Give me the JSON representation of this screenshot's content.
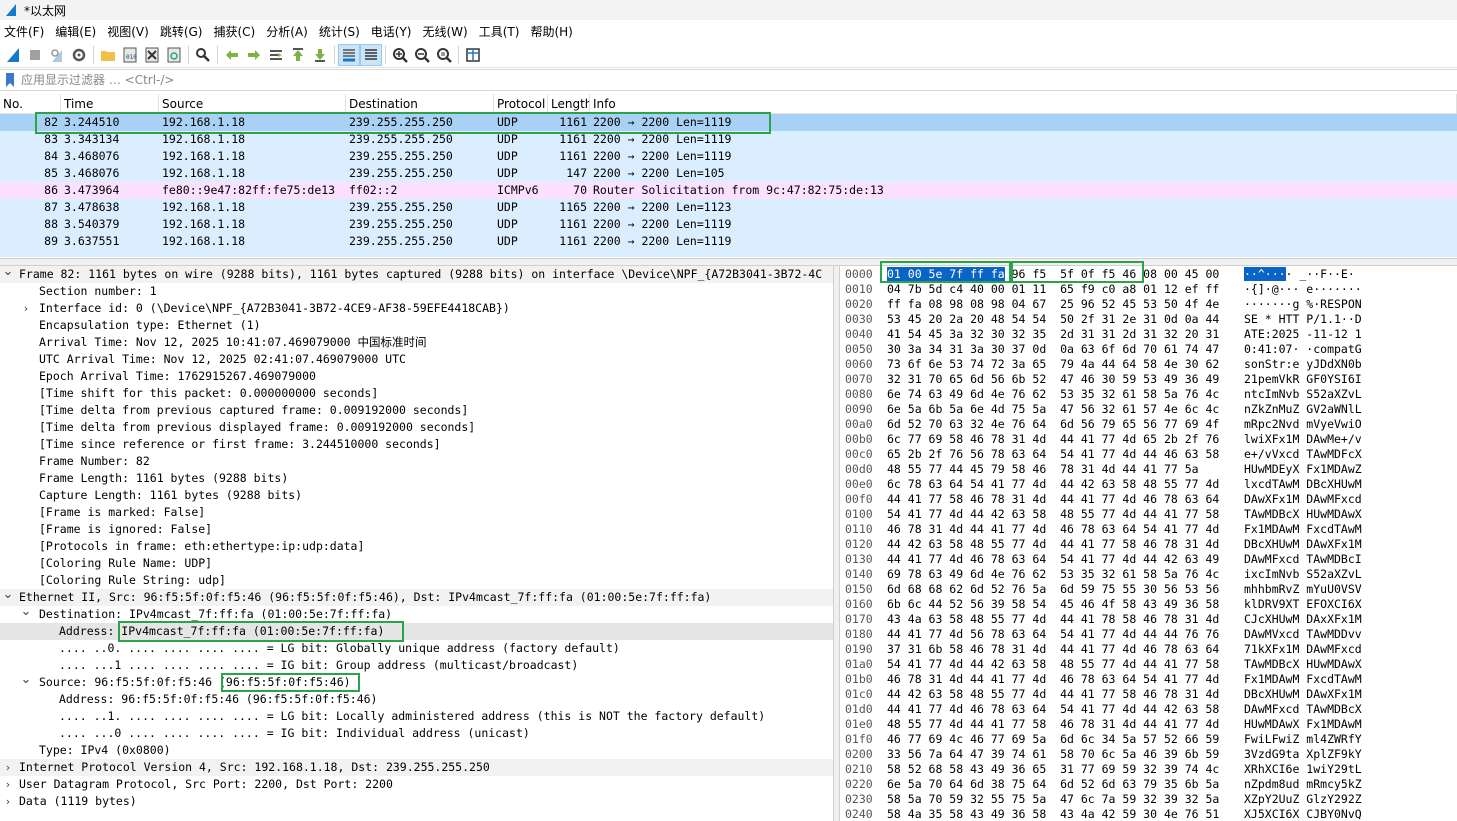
{
  "window": {
    "title": "*以太网"
  },
  "menu": [
    "文件(F)",
    "编辑(E)",
    "视图(V)",
    "跳转(G)",
    "捕获(C)",
    "分析(A)",
    "统计(S)",
    "电话(Y)",
    "无线(W)",
    "工具(T)",
    "帮助(H)"
  ],
  "toolbar": {
    "icons": [
      "shark-fin-start-icon",
      "stop-square-icon",
      "restart-fin-icon",
      "options-gear-icon",
      "open-folder-icon",
      "save-file-icon",
      "close-file-icon",
      "reload-icon",
      "find-magnifier-icon",
      "go-back-arrow-icon",
      "go-forward-arrow-icon",
      "go-to-packet-icon",
      "go-first-icon",
      "go-last-icon",
      "autoscroll-icon",
      "colorize-icon",
      "zoom-in-icon",
      "zoom-out-icon",
      "zoom-normal-icon",
      "resize-columns-icon"
    ]
  },
  "filter": {
    "placeholder": "应用显示过滤器 … <Ctrl-/>"
  },
  "packet_list": {
    "columns": [
      "No.",
      "Time",
      "Source",
      "Destination",
      "Protocol",
      "Length",
      "Info"
    ],
    "rows": [
      {
        "no": "82",
        "time": "3.244510",
        "src": "192.168.1.18",
        "dst": "239.255.255.250",
        "proto": "UDP",
        "len": "1161",
        "info": "2200 → 2200 Len=1119",
        "style": "selected"
      },
      {
        "no": "83",
        "time": "3.343134",
        "src": "192.168.1.18",
        "dst": "239.255.255.250",
        "proto": "UDP",
        "len": "1161",
        "info": "2200 → 2200 Len=1119",
        "style": "udp"
      },
      {
        "no": "84",
        "time": "3.468076",
        "src": "192.168.1.18",
        "dst": "239.255.255.250",
        "proto": "UDP",
        "len": "1161",
        "info": "2200 → 2200 Len=1119",
        "style": "udp"
      },
      {
        "no": "85",
        "time": "3.468076",
        "src": "192.168.1.18",
        "dst": "239.255.255.250",
        "proto": "UDP",
        "len": "147",
        "info": "2200 → 2200 Len=105",
        "style": "udp"
      },
      {
        "no": "86",
        "time": "3.473964",
        "src": "fe80::9e47:82ff:fe75:de13",
        "dst": "ff02::2",
        "proto": "ICMPv6",
        "len": "70",
        "info": "Router Solicitation from 9c:47:82:75:de:13",
        "style": "icmp"
      },
      {
        "no": "87",
        "time": "3.478638",
        "src": "192.168.1.18",
        "dst": "239.255.255.250",
        "proto": "UDP",
        "len": "1165",
        "info": "2200 → 2200 Len=1123",
        "style": "udp"
      },
      {
        "no": "88",
        "time": "3.540379",
        "src": "192.168.1.18",
        "dst": "239.255.255.250",
        "proto": "UDP",
        "len": "1161",
        "info": "2200 → 2200 Len=1119",
        "style": "udp"
      },
      {
        "no": "89",
        "time": "3.637551",
        "src": "192.168.1.18",
        "dst": "239.255.255.250",
        "proto": "UDP",
        "len": "1161",
        "info": "2200 → 2200 Len=1119",
        "style": "udp"
      }
    ]
  },
  "details": [
    {
      "indent": 0,
      "arrow": "open",
      "text": "Frame 82: 1161 bytes on wire (9288 bits), 1161 bytes captured (9288 bits) on interface \\Device\\NPF_{A72B3041-3B72-4C",
      "style": "top"
    },
    {
      "indent": 1,
      "arrow": "",
      "text": "Section number: 1"
    },
    {
      "indent": 1,
      "arrow": "closed",
      "text": "Interface id: 0 (\\Device\\NPF_{A72B3041-3B72-4CE9-AF38-59EFE4418CAB})"
    },
    {
      "indent": 1,
      "arrow": "",
      "text": "Encapsulation type: Ethernet (1)"
    },
    {
      "indent": 1,
      "arrow": "",
      "text": "Arrival Time: Nov 12, 2025 10:41:07.469079000 中国标准时间"
    },
    {
      "indent": 1,
      "arrow": "",
      "text": "UTC Arrival Time: Nov 12, 2025 02:41:07.469079000 UTC"
    },
    {
      "indent": 1,
      "arrow": "",
      "text": "Epoch Arrival Time: 1762915267.469079000"
    },
    {
      "indent": 1,
      "arrow": "",
      "text": "[Time shift for this packet: 0.000000000 seconds]"
    },
    {
      "indent": 1,
      "arrow": "",
      "text": "[Time delta from previous captured frame: 0.009192000 seconds]"
    },
    {
      "indent": 1,
      "arrow": "",
      "text": "[Time delta from previous displayed frame: 0.009192000 seconds]"
    },
    {
      "indent": 1,
      "arrow": "",
      "text": "[Time since reference or first frame: 3.244510000 seconds]"
    },
    {
      "indent": 1,
      "arrow": "",
      "text": "Frame Number: 82"
    },
    {
      "indent": 1,
      "arrow": "",
      "text": "Frame Length: 1161 bytes (9288 bits)"
    },
    {
      "indent": 1,
      "arrow": "",
      "text": "Capture Length: 1161 bytes (9288 bits)"
    },
    {
      "indent": 1,
      "arrow": "",
      "text": "[Frame is marked: False]"
    },
    {
      "indent": 1,
      "arrow": "",
      "text": "[Frame is ignored: False]"
    },
    {
      "indent": 1,
      "arrow": "",
      "text": "[Protocols in frame: eth:ethertype:ip:udp:data]"
    },
    {
      "indent": 1,
      "arrow": "",
      "text": "[Coloring Rule Name: UDP]"
    },
    {
      "indent": 1,
      "arrow": "",
      "text": "[Coloring Rule String: udp]"
    },
    {
      "indent": 0,
      "arrow": "open",
      "text": "Ethernet II, Src: 96:f5:5f:0f:f5:46 (96:f5:5f:0f:f5:46), Dst: IPv4mcast_7f:ff:fa (01:00:5e:7f:ff:fa)",
      "style": "top"
    },
    {
      "indent": 1,
      "arrow": "open",
      "text": "Destination: IPv4mcast_7f:ff:fa (01:00:5e:7f:ff:fa)"
    },
    {
      "indent": 2,
      "arrow": "",
      "text": "Address: IPv4mcast_7f:ff:fa (01:00:5e:7f:ff:fa)",
      "style": "sel"
    },
    {
      "indent": 2,
      "arrow": "",
      "text": ".... ..0. .... .... .... .... = LG bit: Globally unique address (factory default)"
    },
    {
      "indent": 2,
      "arrow": "",
      "text": ".... ...1 .... .... .... .... = IG bit: Group address (multicast/broadcast)"
    },
    {
      "indent": 1,
      "arrow": "open",
      "text": "Source: 96:f5:5f:0f:f5:46 (96:f5:5f:0f:f5:46)"
    },
    {
      "indent": 2,
      "arrow": "",
      "text": "Address: 96:f5:5f:0f:f5:46 (96:f5:5f:0f:f5:46)"
    },
    {
      "indent": 2,
      "arrow": "",
      "text": ".... ..1. .... .... .... .... = LG bit: Locally administered address (this is NOT the factory default)"
    },
    {
      "indent": 2,
      "arrow": "",
      "text": ".... ...0 .... .... .... .... = IG bit: Individual address (unicast)"
    },
    {
      "indent": 1,
      "arrow": "",
      "text": "Type: IPv4 (0x0800)"
    },
    {
      "indent": 0,
      "arrow": "closed",
      "text": "Internet Protocol Version 4, Src: 192.168.1.18, Dst: 239.255.255.250",
      "style": "top"
    },
    {
      "indent": 0,
      "arrow": "closed",
      "text": "User Datagram Protocol, Src Port: 2200, Dst Port: 2200"
    },
    {
      "indent": 0,
      "arrow": "closed",
      "text": "Data (1119 bytes)"
    }
  ],
  "hex": [
    {
      "off": "0000",
      "bytes": "01 00 5e 7f ff fa 96 f5  5f 0f f5 46 08 00 45 00",
      "ascii": "··^···· _··F··E·"
    },
    {
      "off": "0010",
      "bytes": "04 7b 5d c4 40 00 01 11  65 f9 c0 a8 01 12 ef ff",
      "ascii": "·{]·@··· e·······"
    },
    {
      "off": "0020",
      "bytes": "ff fa 08 98 08 98 04 67  25 96 52 45 53 50 4f 4e",
      "ascii": "·······g %·RESPON"
    },
    {
      "off": "0030",
      "bytes": "53 45 20 2a 20 48 54 54  50 2f 31 2e 31 0d 0a 44",
      "ascii": "SE * HTT P/1.1··D"
    },
    {
      "off": "0040",
      "bytes": "41 54 45 3a 32 30 32 35  2d 31 31 2d 31 32 20 31",
      "ascii": "ATE:2025 -11-12 1"
    },
    {
      "off": "0050",
      "bytes": "30 3a 34 31 3a 30 37 0d  0a 63 6f 6d 70 61 74 47",
      "ascii": "0:41:07· ·compatG"
    },
    {
      "off": "0060",
      "bytes": "73 6f 6e 53 74 72 3a 65  79 4a 44 64 58 4e 30 62",
      "ascii": "sonStr:e yJDdXN0b"
    },
    {
      "off": "0070",
      "bytes": "32 31 70 65 6d 56 6b 52  47 46 30 59 53 49 36 49",
      "ascii": "21pemVkR GF0YSI6I"
    },
    {
      "off": "0080",
      "bytes": "6e 74 63 49 6d 4e 76 62  53 35 32 61 58 5a 76 4c",
      "ascii": "ntcImNvb S52aXZvL"
    },
    {
      "off": "0090",
      "bytes": "6e 5a 6b 5a 6e 4d 75 5a  47 56 32 61 57 4e 6c 4c",
      "ascii": "nZkZnMuZ GV2aWNlL"
    },
    {
      "off": "00a0",
      "bytes": "6d 52 70 63 32 4e 76 64  6d 56 79 65 56 77 69 4f",
      "ascii": "mRpc2Nvd mVyeVwiO"
    },
    {
      "off": "00b0",
      "bytes": "6c 77 69 58 46 78 31 4d  44 41 77 4d 65 2b 2f 76",
      "ascii": "lwiXFx1M DAwMe+/v"
    },
    {
      "off": "00c0",
      "bytes": "65 2b 2f 76 56 78 63 64  54 41 77 4d 44 46 63 58",
      "ascii": "e+/vVxcd TAwMDFcX"
    },
    {
      "off": "00d0",
      "bytes": "48 55 77 44 45 79 58 46  78 31 4d 44 41 77 5a",
      "ascii": "HUwMDEyX Fx1MDAwZ"
    },
    {
      "off": "00e0",
      "bytes": "6c 78 63 64 54 41 77 4d  44 42 63 58 48 55 77 4d",
      "ascii": "lxcdTAwM DBcXHUwM"
    },
    {
      "off": "00f0",
      "bytes": "44 41 77 58 46 78 31 4d  44 41 77 4d 46 78 63 64",
      "ascii": "DAwXFx1M DAwMFxcd"
    },
    {
      "off": "0100",
      "bytes": "54 41 77 4d 44 42 63 58  48 55 77 4d 44 41 77 58",
      "ascii": "TAwMDBcX HUwMDAwX"
    },
    {
      "off": "0110",
      "bytes": "46 78 31 4d 44 41 77 4d  46 78 63 64 54 41 77 4d",
      "ascii": "Fx1MDAwM FxcdTAwM"
    },
    {
      "off": "0120",
      "bytes": "44 42 63 58 48 55 77 4d  44 41 77 58 46 78 31 4d",
      "ascii": "DBcXHUwM DAwXFx1M"
    },
    {
      "off": "0130",
      "bytes": "44 41 77 4d 46 78 63 64  54 41 77 4d 44 42 63 49",
      "ascii": "DAwMFxcd TAwMDBcI"
    },
    {
      "off": "0140",
      "bytes": "69 78 63 49 6d 4e 76 62  53 35 32 61 58 5a 76 4c",
      "ascii": "ixcImNvb S52aXZvL"
    },
    {
      "off": "0150",
      "bytes": "6d 68 68 62 6d 52 76 5a  6d 59 75 55 30 56 53 56",
      "ascii": "mhhbmRvZ mYuU0VSV"
    },
    {
      "off": "0160",
      "bytes": "6b 6c 44 52 56 39 58 54  45 46 4f 58 43 49 36 58",
      "ascii": "klDRV9XT EFOXCI6X"
    },
    {
      "off": "0170",
      "bytes": "43 4a 63 58 48 55 77 4d  44 41 78 58 46 78 31 4d",
      "ascii": "CJcXHUwM DAxXFx1M"
    },
    {
      "off": "0180",
      "bytes": "44 41 77 4d 56 78 63 64  54 41 77 4d 44 44 76 76",
      "ascii": "DAwMVxcd TAwMDDvv"
    },
    {
      "off": "0190",
      "bytes": "37 31 6b 58 46 78 31 4d  44 41 77 4d 46 78 63 64",
      "ascii": "71kXFx1M DAwMFxcd"
    },
    {
      "off": "01a0",
      "bytes": "54 41 77 4d 44 42 63 58  48 55 77 4d 44 41 77 58",
      "ascii": "TAwMDBcX HUwMDAwX"
    },
    {
      "off": "01b0",
      "bytes": "46 78 31 4d 44 41 77 4d  46 78 63 64 54 41 77 4d",
      "ascii": "Fx1MDAwM FxcdTAwM"
    },
    {
      "off": "01c0",
      "bytes": "44 42 63 58 48 55 77 4d  44 41 77 58 46 78 31 4d",
      "ascii": "DBcXHUwM DAwXFx1M"
    },
    {
      "off": "01d0",
      "bytes": "44 41 77 4d 46 78 63 64  54 41 77 4d 44 42 63 58",
      "ascii": "DAwMFxcd TAwMDBcX"
    },
    {
      "off": "01e0",
      "bytes": "48 55 77 4d 44 41 77 58  46 78 31 4d 44 41 77 4d",
      "ascii": "HUwMDAwX Fx1MDAwM"
    },
    {
      "off": "01f0",
      "bytes": "46 77 69 4c 46 77 69 5a  6d 6c 34 5a 57 52 66 59",
      "ascii": "FwiLFwiZ ml4ZWRfY"
    },
    {
      "off": "0200",
      "bytes": "33 56 7a 64 47 39 74 61  58 70 6c 5a 46 39 6b 59",
      "ascii": "3VzdG9ta XplZF9kY"
    },
    {
      "off": "0210",
      "bytes": "58 52 68 58 43 49 36 65  31 77 69 59 32 39 74 4c",
      "ascii": "XRhXCI6e 1wiY29tL"
    },
    {
      "off": "0220",
      "bytes": "6e 5a 70 64 6d 38 75 64  6d 52 6d 63 79 35 6b 5a",
      "ascii": "nZpdm8ud mRmcy5kZ"
    },
    {
      "off": "0230",
      "bytes": "58 5a 70 59 32 55 75 5a  47 6c 7a 59 32 39 32 5a",
      "ascii": "XZpY2UuZ GlzY292Z"
    },
    {
      "off": "0240",
      "bytes": "58 4a 35 58 43 49 36 58  43 4a 42 59 30 4e 76 51",
      "ascii": "XJ5XCI6X CJBY0NvQ"
    }
  ]
}
